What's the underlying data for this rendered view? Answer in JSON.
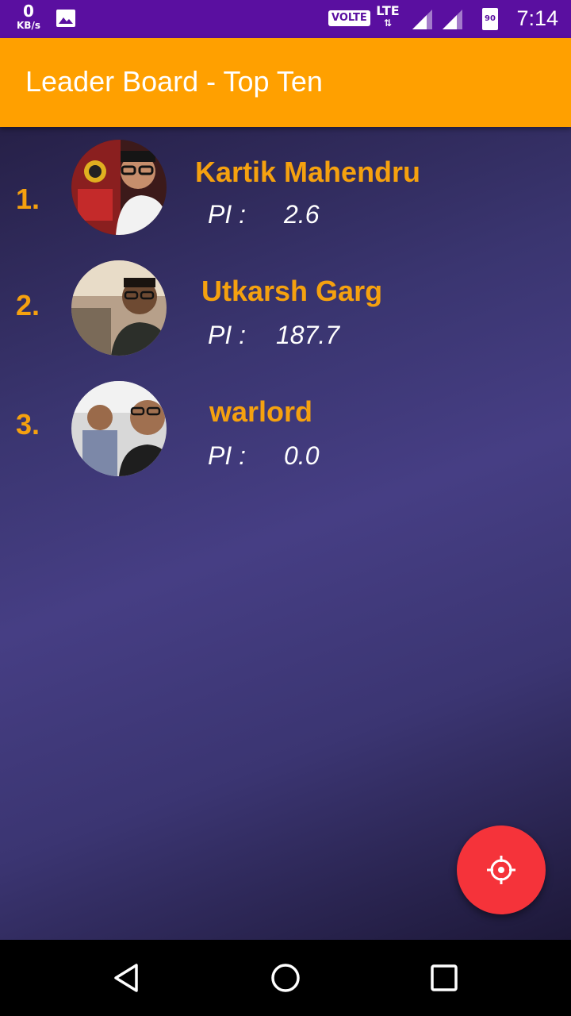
{
  "status_bar": {
    "speed_value": "0",
    "speed_unit": "KB/s",
    "volte": "VOLTE",
    "network": "LTE",
    "battery": "90",
    "time": "7:14"
  },
  "app_bar": {
    "title": "Leader Board - Top Ten"
  },
  "leaderboard": {
    "pi_label": "PI :",
    "entries": [
      {
        "rank": "1.",
        "name": "Kartik Mahendru",
        "pi": "2.6"
      },
      {
        "rank": "2.",
        "name": "Utkarsh Garg",
        "pi": "187.7"
      },
      {
        "rank": "3.",
        "name": "warlord",
        "pi": "0.0"
      }
    ]
  },
  "fab": {
    "icon": "target-crosshair-icon"
  },
  "colors": {
    "status_bar": "#5a0fa0",
    "app_bar": "#ffa000",
    "accent_text": "#f5a10f",
    "fab": "#f5333a"
  }
}
